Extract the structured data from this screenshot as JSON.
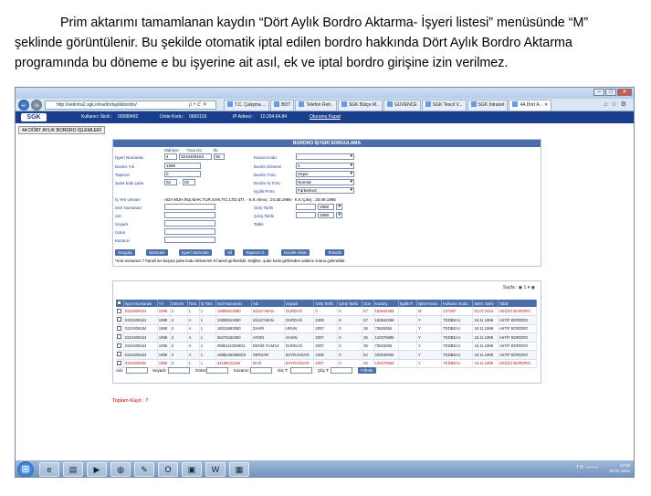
{
  "caption": {
    "line1": "Prim aktarımı tamamlanan kaydın “Dört Aylık Bordro Aktarma- İşyeri listesi” menüsünde “M”",
    "line2": "şeklinde görüntülenir. Bu şekilde otomatik iptal edilen bordro hakkında  Dört Aylık Bordro Aktarma",
    "line3": "programında bu döneme e bu işyerine ait asıl, ek ve iptal bordro girişine izin verilmez."
  },
  "browser": {
    "url": "http://setintra2.sgk.intra/dortaylikbordro/",
    "addr_controls": "ρ • ℭ ✕",
    "tabs": [
      "T.C. Çalışma ...",
      "BOT",
      "Telefon Reh..",
      "SGK Bütçe M..",
      "GÜVENCE",
      "SGK Tescil V...",
      "SGK İntranet",
      "4A Dört A... ✕"
    ]
  },
  "header": {
    "logo": "SGK",
    "user_label": "Kullanıcı Sicili :",
    "user_value": "00088492",
    "unit_label": "Ünite Kodu :",
    "unit_value": "0660103",
    "ip_label": "IP Adresi :",
    "ip_value": "10.204.64.84",
    "logout": "Oturumu Kapat"
  },
  "module_button": "4A DÖRT AYLIK BORDRO İŞLEMLERİ",
  "form": {
    "title": "BORDRO İŞYERİ SORGULAMA",
    "col_headers": {
      "mahiyet": "Mahiyet",
      "sira": "*Sıra No",
      "ilk": "İlk."
    },
    "isyeri_label": "İşyeri Numarası",
    "isyeri_mahiyet": "4",
    "isyeri_sira": "0210409164",
    "isyeri_il": "06",
    "bordro_yil_label": "Bordro Yılı",
    "bordro_yil": "1998",
    "taseron_label": "Taşeron",
    "taseron": "0",
    "sube_label": "Şube Eski şube",
    "sube1": "02",
    "sube_sep": "-",
    "sube2": "02",
    "kanun_label": "Kanun Kodu",
    "kanun": "-",
    "donem_label": "Bordro Dönemi",
    "donem": "2",
    "turu_label": "Bordro Türü",
    "turu": "Hepsi",
    "isturu_label": "Bordro İş Türü",
    "isturu": "Normal",
    "prim_label": "İşçilik Primi",
    "prim": "Farketmez",
    "unvan_label": "İş Yeri Unvanı",
    "unvan": "ADA MUH.İNŞ.MAK.TUR.SAN.TİC.LTD.ŞTİ. - K.K.Alınış : 24.06.1998 - K.K.Çıkış : 20.09.1998",
    "sicil_label": "Sicil Numarası",
    "adi_label": "Adı",
    "soyadi_label": "Soyadı",
    "gunu_label": "Günü",
    "kazanc_label": "Kazancı",
    "giris_label": "Giriş Tarihi",
    "giris_yil": "1998",
    "cikis_label": "Çıkış Tarihi",
    "cikis_yil": "1998",
    "table_label": "Table",
    "buttons": [
      "Sorgula",
      "Sürücüle",
      "İşyeri Sürücüle",
      "Sil",
      "Taşeron S.",
      "Excele Aktar",
      "Temizle"
    ],
    "note": "*Sıra numarası 7 haneli ise başına şube kodu eklenerek 9 haneli girilmelidir. Değilse, şube kodu girilmeden sadece sırano girilmelidir."
  },
  "grid": {
    "pager_label": "Sayfa :",
    "pager_value": "1",
    "columns": [
      "İşyeri Numarası",
      "Yıl",
      "Dönem",
      "Türü",
      "İş Türü",
      "Sicil Numarası",
      "Adı",
      "Soyadı",
      "Giriş Tarihi",
      "Çıkış Tarihi",
      "Gün",
      "Kazanç",
      "İşçilik P.",
      "İşlem Kodu",
      "Kullanıcı Kodu",
      "İşlem Tarihi",
      "Table"
    ],
    "rows": [
      [
        "0210409164",
        "1998",
        "2",
        "1",
        "1",
        "10808913060",
        "SÜLEYMAN",
        "DURDAĞ",
        "0",
        "0",
        "57",
        "183844358",
        "",
        "M",
        "137367",
        "02.07.2014",
        "GEÇİCİ BORDRO"
      ],
      [
        "0210409164",
        "1998",
        "2",
        "A",
        "1",
        "10808913060",
        "SÜLEYMAN",
        "DURDAĞ",
        "2406",
        "0",
        "57",
        "183844358",
        "",
        "Y",
        "TEDBEA1",
        "18.11.1998",
        "AKTİF BORDRO"
      ],
      [
        "0210409164",
        "1998",
        "2",
        "A",
        "1",
        "18015663060",
        "ZAHİR",
        "URUN",
        "2007",
        "0",
        "35",
        "73626385",
        "",
        "Y",
        "TEDBEA1",
        "18.11.1998",
        "AKTİF BORDRO"
      ],
      [
        "0210409164",
        "1998",
        "2",
        "A",
        "1",
        "56278182060",
        "AYDIN",
        "SAKIN",
        "2007",
        "0",
        "35",
        "120376885",
        "",
        "Y",
        "TEDBEA1",
        "18.11.1998",
        "AKTİF BORDRO"
      ],
      [
        "0210409164",
        "1998",
        "2",
        "A",
        "1",
        "39961110298O2",
        "DENİZ YILMAZ",
        "DURDAĞ",
        "2007",
        "0",
        "35",
        "73626385",
        "",
        "Y",
        "TEDBEA1",
        "18.11.1998",
        "AKTİF BORDRO"
      ],
      [
        "0210409164",
        "1998",
        "2",
        "A",
        "1",
        "19982463558O2",
        "SERDAR",
        "BAYRAKDAR",
        "2406",
        "0",
        "62",
        "200040000",
        "",
        "Y",
        "TEDBEA1",
        "18.11.1998",
        "AKTİF BORDRO"
      ],
      [
        "0210409164",
        "1998",
        "2",
        "1",
        "1",
        "61196431195",
        "MAJİ",
        "BAYRAKDAR",
        "2007",
        "0",
        "35",
        "120376885",
        "",
        "Y",
        "TEDBEA1",
        "18.11.1998",
        "GEÇİCİ BORDRO"
      ]
    ],
    "filters": {
      "adi": "Adı:",
      "soyadi": "Soyadı:",
      "gunu": "Günü:",
      "kazanc": "Kazancı:",
      "giris": "Giş T:",
      "cikis": "Çkş T:",
      "button": "Filtrele"
    },
    "total": "Toplam Kayıt : 7"
  },
  "taskbar": {
    "time": "10:38",
    "date": "02.07.2014",
    "lang": "TR"
  }
}
